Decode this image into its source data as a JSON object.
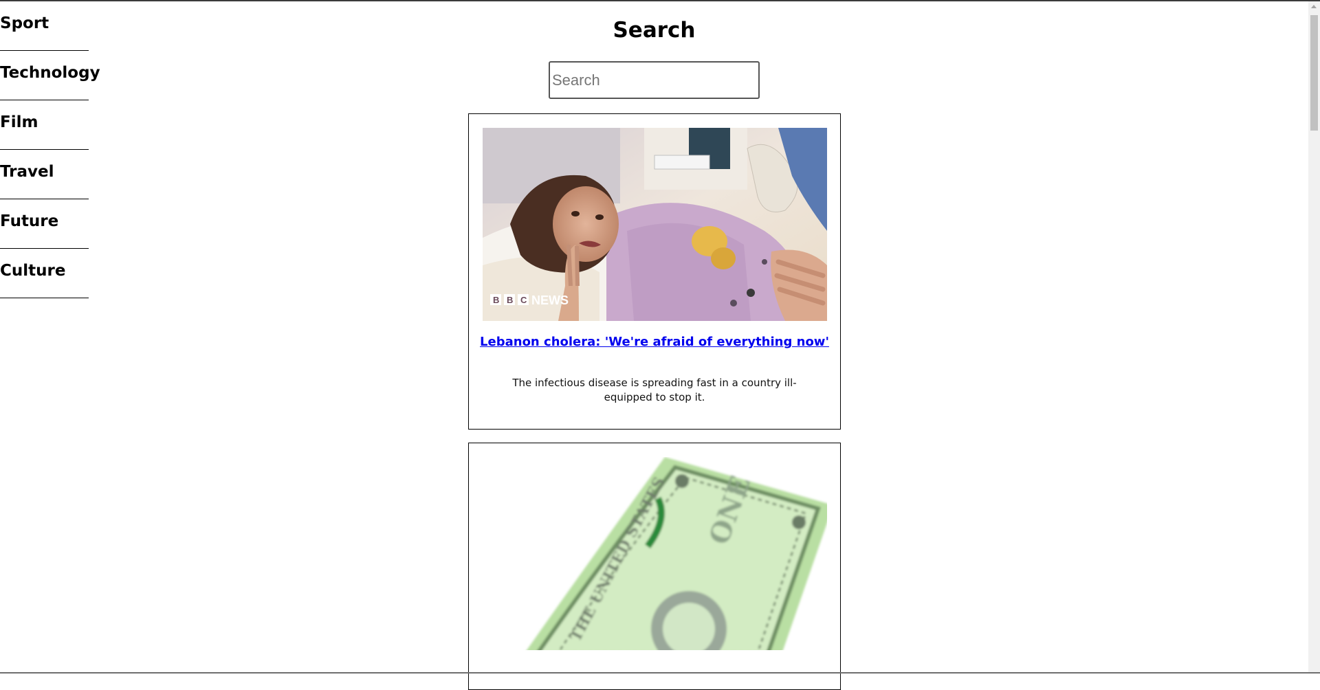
{
  "sidebar": {
    "items": [
      {
        "label": "Sport"
      },
      {
        "label": "Technology"
      },
      {
        "label": "Film"
      },
      {
        "label": "Travel"
      },
      {
        "label": "Future"
      },
      {
        "label": "Culture"
      }
    ]
  },
  "header": {
    "title": "Search"
  },
  "search": {
    "placeholder": "Search",
    "value": ""
  },
  "articles": [
    {
      "title": "Lebanon cholera: 'We're afraid of everything now'",
      "description": "The infectious disease is spreading fast in a country ill-equipped to stop it.",
      "image_watermark": "BBC NEWS"
    },
    {
      "title": "",
      "description": ""
    }
  ],
  "colors": {
    "link": "#0000ee",
    "border": "#000000",
    "background": "#ffffff"
  }
}
